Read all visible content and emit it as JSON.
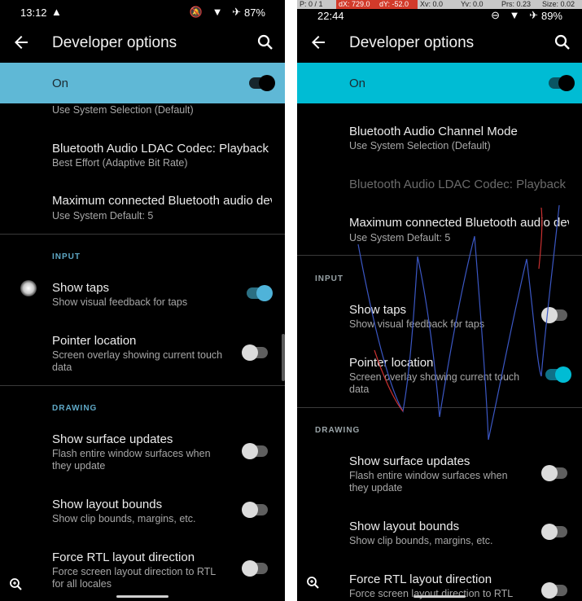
{
  "colors": {
    "left_accent": "#5fb8d6",
    "right_accent": "#00bcd4",
    "section_left": "#5fa8c6",
    "section_right": "#9aa4a8"
  },
  "left": {
    "status": {
      "time": "13:12",
      "nav_glyph": "▲",
      "icons": "🔕 ▼ ✈",
      "battery": "87%"
    },
    "toolbar": {
      "title": "Developer options"
    },
    "master": {
      "label": "On"
    },
    "rows": [
      {
        "sub": "Use System Selection (Default)"
      },
      {
        "title": "Bluetooth Audio LDAC Codec: Playback Quality",
        "sub": "Best Effort (Adaptive Bit Rate)"
      },
      {
        "title": "Maximum connected Bluetooth audio devices",
        "sub": "Use System Default: 5"
      },
      {
        "title": "Show taps",
        "sub": "Show visual feedback for taps"
      },
      {
        "title": "Pointer location",
        "sub": "Screen overlay showing current touch data"
      },
      {
        "title": "Show surface updates",
        "sub": "Flash entire window surfaces when they update"
      },
      {
        "title": "Show layout bounds",
        "sub": "Show clip bounds, margins, etc."
      },
      {
        "title": "Force RTL layout direction",
        "sub": "Force screen layout direction to RTL for all locales"
      }
    ],
    "sections": {
      "input": "INPUT",
      "drawing": "DRAWING"
    }
  },
  "right": {
    "overlay": {
      "p": "P: 0 / 1",
      "dx": "dX: 729.0",
      "dy": "dY: -52.0",
      "xv": "Xv: 0.0",
      "yv": "Yv: 0.0",
      "prs": "Prs: 0.23",
      "size": "Size: 0.02"
    },
    "status": {
      "time": "22:44",
      "icons": "⊖ ▼ ✈",
      "battery": "89%"
    },
    "toolbar": {
      "title": "Developer options"
    },
    "master": {
      "label": "On"
    },
    "rows": [
      {
        "title": "Bluetooth Audio Channel Mode",
        "sub": "Use System Selection (Default)"
      },
      {
        "title": "Bluetooth Audio LDAC Codec: Playback Quality"
      },
      {
        "title": "Maximum connected Bluetooth audio devices",
        "sub": "Use System Default: 5"
      },
      {
        "title": "Show taps",
        "sub": "Show visual feedback for taps"
      },
      {
        "title": "Pointer location",
        "sub": "Screen overlay showing current touch data"
      },
      {
        "title": "Show surface updates",
        "sub": "Flash entire window surfaces when they update"
      },
      {
        "title": "Show layout bounds",
        "sub": "Show clip bounds, margins, etc."
      },
      {
        "title": "Force RTL layout direction",
        "sub": "Force screen layout direction to RTL"
      }
    ],
    "sections": {
      "input": "INPUT",
      "drawing": "DRAWING"
    }
  },
  "icons": {
    "back": "arrow-left-icon",
    "search": "search-icon",
    "zoom": "magnifier-zoom-icon"
  }
}
